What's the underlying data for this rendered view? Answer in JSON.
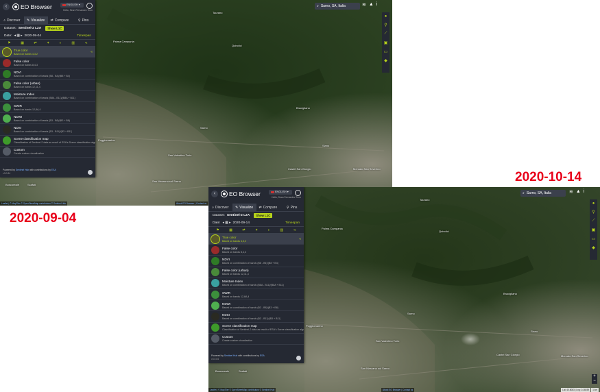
{
  "captions": {
    "first": "2020-09-04",
    "second": "2020-10-14"
  },
  "colors": {
    "caption": "#e8001a",
    "accent": "#b7d31b",
    "panel": "#252933"
  },
  "app": {
    "title": "EO Browser",
    "language": "ENGLISH",
    "user": "Hello, Sean Fernandez Tenn",
    "tabs": [
      {
        "label": "Discover",
        "icon": "search-icon"
      },
      {
        "label": "Visualize",
        "icon": "pencil-icon"
      },
      {
        "label": "Compare",
        "icon": "compare-icon"
      },
      {
        "label": "Pins",
        "icon": "pin-icon"
      }
    ],
    "dataset_label": "Dataset:",
    "dataset": "Sentinel-2 L2A",
    "show_l1c": "Show L1C",
    "date_label": "Date:",
    "timespan": "Timespan",
    "search": "Sarno, SA, Italia",
    "footer_powered": "Powered by",
    "footer_link": "Sentinel Hub",
    "footer_with": "with contributions by",
    "footer_link2": "ESA",
    "attribution": "Leaflet | © MapTiler © OpenStreetMap contributors © Sentinel Hub",
    "about": "About EO Browser | Contact us",
    "coords": "Lat: 40.8083 | Lng: 14.6039",
    "scale": "1 km"
  },
  "layers": [
    {
      "title": "True color",
      "desc": "Based on bands 4,3,2",
      "color": "#5a5a28",
      "selected": true
    },
    {
      "title": "False color",
      "desc": "Based on bands 8,4,3",
      "color": "#9a2a2a",
      "selected": false
    },
    {
      "title": "NDVI",
      "desc": "Based on combination of bands (B8 - B4)/(B8 + B4)",
      "color": "#2f7a26",
      "selected": false
    },
    {
      "title": "False color (urban)",
      "desc": "Based on bands 12,11,4",
      "color": "#4a8a3a",
      "selected": false
    },
    {
      "title": "Moisture Index",
      "desc": "Based on combination of bands (B8A - B11)/(B8A + B11)",
      "color": "#3aa0a0",
      "selected": false
    },
    {
      "title": "SWIR",
      "desc": "Based on bands 12,8A,4",
      "color": "#3c8f3c",
      "selected": false
    },
    {
      "title": "NDWI",
      "desc": "Based on combination of bands (B3 - B8)/(B3 + B8)",
      "color": "#4fae4f",
      "selected": false
    },
    {
      "title": "NDSI",
      "desc": "Based on combination of bands (B3 - B11)/(B3 + B11)",
      "color": "#2a2a22",
      "selected": false
    },
    {
      "title": "Scene classification map",
      "desc": "Classification of Sentinel-2 data as result of ESA's Scene classification algorithm",
      "color": "#3e9a2a",
      "selected": false
    },
    {
      "title": "Custom",
      "desc": "Create custom visualization",
      "color": "#555b66",
      "selected": false
    }
  ],
  "shot1": {
    "date": "2020-09-04",
    "version": "v3.0.84"
  },
  "shot2": {
    "date": "2020-09-14",
    "version": "v3.0.84"
  },
  "towns": [
    {
      "name": "Palma Campania"
    },
    {
      "name": "Sarno"
    },
    {
      "name": "Bracigliano"
    },
    {
      "name": "Siano"
    },
    {
      "name": "San Valentino Torio"
    },
    {
      "name": "San Marzano sul Sarno"
    },
    {
      "name": "Castel San Giorgio"
    },
    {
      "name": "Mercato San Severino"
    },
    {
      "name": "Poggiomarino"
    },
    {
      "name": "Boscoreale"
    },
    {
      "name": "Scafati"
    },
    {
      "name": "Quindici"
    },
    {
      "name": "Taurano"
    }
  ]
}
